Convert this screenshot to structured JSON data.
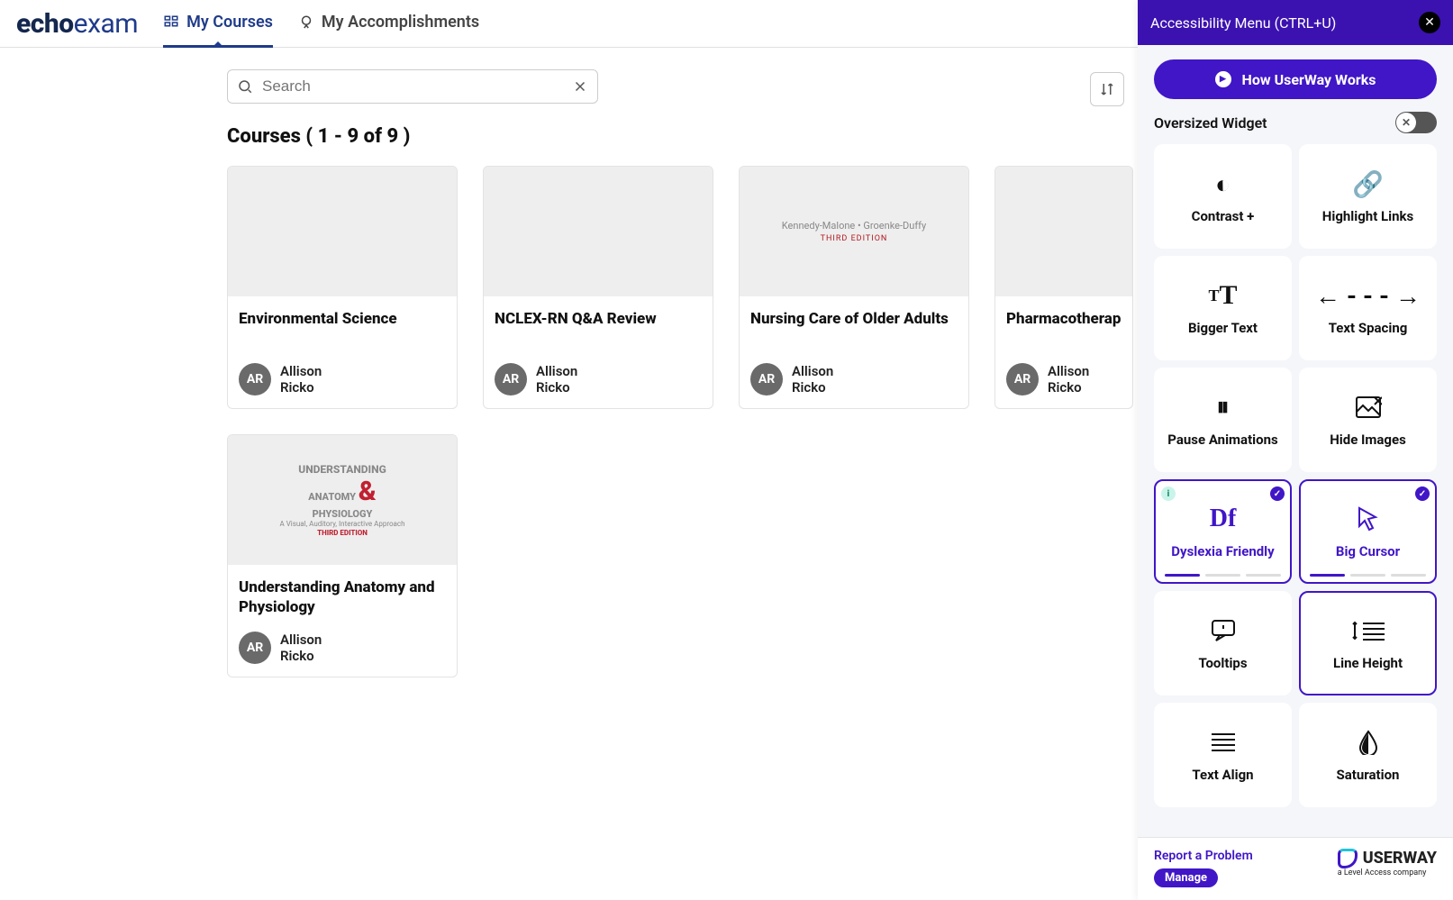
{
  "brand": {
    "part1": "echo",
    "part2": "exam"
  },
  "nav": {
    "courses": "My Courses",
    "accomplishments": "My Accomplishments"
  },
  "search": {
    "placeholder": "Search"
  },
  "heading": "Courses ( 1 - 9 of 9 )",
  "author": {
    "initials": "AR",
    "first": "Allison",
    "last": "Ricko"
  },
  "courses": [
    {
      "title": "Environmental Science"
    },
    {
      "title": "NCLEX-RN Q&A Review"
    },
    {
      "title": "Nursing Care of Older Adults"
    },
    {
      "title": "Pharmacotherap"
    },
    {
      "title": "Understanding Anatomy and Physiology"
    }
  ],
  "thumb3": {
    "line1": "Kennedy-Malone • Groenke-Duffy",
    "line2": "THIRD EDITION"
  },
  "thumb5": {
    "line1": "UNDERSTANDING",
    "line2a": "ANATOMY ",
    "amp": "&",
    "line3": "PHYSIOLOGY",
    "sub": "A Visual, Auditory, Interactive Approach",
    "ed": "THIRD EDITION"
  },
  "a11y": {
    "title": "Accessibility Menu (CTRL+U)",
    "how": "How UserWay Works",
    "oversized": "Oversized Widget",
    "tiles": {
      "contrast": "Contrast +",
      "links": "Highlight Links",
      "bigger": "Bigger Text",
      "spacing": "Text Spacing",
      "pause": "Pause Animations",
      "hideimg": "Hide Images",
      "dyslexia": "Dyslexia Friendly",
      "cursor": "Big Cursor",
      "tooltips": "Tooltips",
      "lineheight": "Line Height",
      "align": "Text Align",
      "saturation": "Saturation"
    },
    "dyslexia_icon": "Df",
    "report": "Report a Problem",
    "manage": "Manage",
    "userway": "USERWAY",
    "userway_sub": "a Level Access company"
  }
}
